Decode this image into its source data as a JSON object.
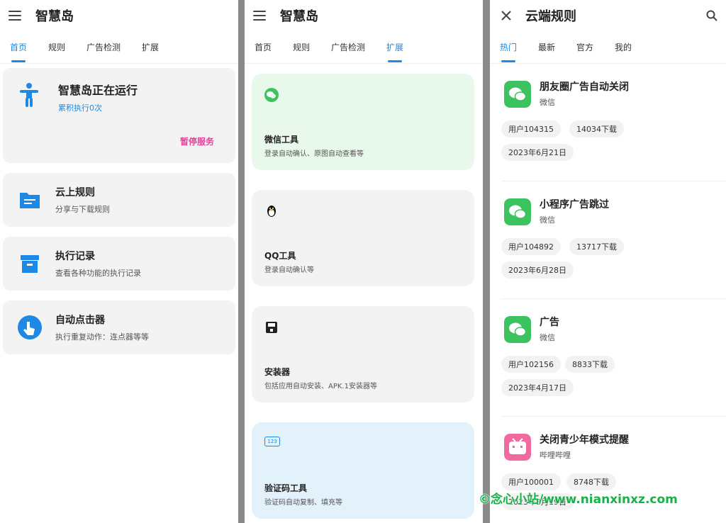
{
  "screen1": {
    "title": "智慧岛",
    "tabs": [
      "首页",
      "规则",
      "广告检测",
      "扩展"
    ],
    "status": {
      "title": "智慧岛正在运行",
      "subtitle": "累积执行0次",
      "pause_label": "暂停服务"
    },
    "menu": [
      {
        "title": "云上规则",
        "subtitle": "分享与下载规则",
        "icon": "folder-icon"
      },
      {
        "title": "执行记录",
        "subtitle": "查看各种功能的执行记录",
        "icon": "archive-icon"
      },
      {
        "title": "自动点击器",
        "subtitle": "执行重复动作：连点器等等",
        "icon": "tap-icon"
      }
    ]
  },
  "screen2": {
    "title": "智慧岛",
    "tabs": [
      "首页",
      "规则",
      "广告检测",
      "扩展"
    ],
    "cards": [
      {
        "title": "微信工具",
        "subtitle": "登录自动确认、原图自动查看等",
        "color": "#e8f8ea",
        "icon": "wechat-icon"
      },
      {
        "title": "QQ工具",
        "subtitle": "登录自动确认等",
        "color": "#f3f3f3",
        "icon": "qq-penguin-icon"
      },
      {
        "title": "安装器",
        "subtitle": "包括应用自动安装、APK.1安装器等",
        "color": "#f3f3f3",
        "icon": "installer-icon"
      },
      {
        "title": "验证码工具",
        "subtitle": "验证码自动复制、填充等",
        "color": "#e3f1fb",
        "icon": "code-123-icon",
        "icon_text": "123"
      }
    ]
  },
  "screen3": {
    "title": "云端规则",
    "tabs": [
      "热门",
      "最新",
      "官方",
      "我的"
    ],
    "rules": [
      {
        "name": "朋友圈广告自动关闭",
        "app": "微信",
        "user": "用户104315",
        "downloads": "14034下载",
        "date": "2023年6月21日",
        "icon": "wechat-app-icon",
        "icon_color": "#3cc35f"
      },
      {
        "name": "小程序广告跳过",
        "app": "微信",
        "user": "用户104892",
        "downloads": "13717下载",
        "date": "2023年6月28日",
        "icon": "wechat-app-icon",
        "icon_color": "#3cc35f"
      },
      {
        "name": "广告",
        "app": "微信",
        "user": "用户102156",
        "downloads": "8833下载",
        "date": "2023年4月17日",
        "icon": "wechat-app-icon",
        "icon_color": "#3cc35f"
      },
      {
        "name": "关闭青少年模式提醒",
        "app": "哔哩哔哩",
        "user": "用户100001",
        "downloads": "8748下载",
        "date": "2023年3月19日",
        "icon": "bilibili-app-icon",
        "icon_color": "#f06aa0"
      }
    ]
  },
  "watermark": "©念心小站/www.nianxinxz.com",
  "accent": "#1e88e5",
  "pause_color": "#e0449b"
}
